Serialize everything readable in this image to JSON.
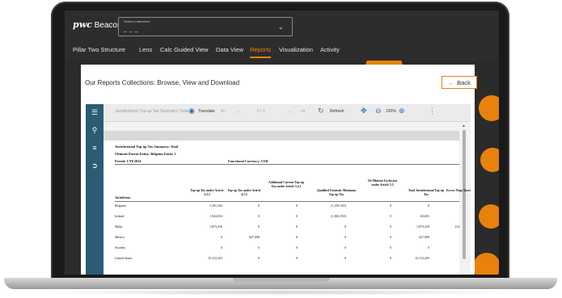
{
  "app": {
    "logo_bold": "pwc",
    "logo_text": "Beacon"
  },
  "selector": {
    "label": "Select a reference",
    "value": "_ _ _"
  },
  "nav": {
    "tabs": [
      {
        "label": "Pillar Two Structure"
      },
      {
        "label": "Lens"
      },
      {
        "label": "Calc Guided View"
      },
      {
        "label": "Data View"
      },
      {
        "label": "Reports"
      },
      {
        "label": "Visualization"
      },
      {
        "label": "Activity"
      }
    ]
  },
  "panel": {
    "title": "Our Reports Collections: Browse, View and Download",
    "back_label": "Back"
  },
  "toolbar": {
    "report_name": "Jurisdictional Top-up Tax Summary: Total",
    "translate": "Translate",
    "page": "1 / 1",
    "refresh": "Refresh",
    "zoom": "100%"
  },
  "report": {
    "title": "Jurisdictional Top-up Tax Summary: Total",
    "entity": "Ultimate Parent Entity: Belgium Entity 1",
    "period": "Period: CYE2024",
    "currency": "Functional Currency: USD",
    "columns": [
      "Jurisdiction",
      "Top-up Tax under Article 5.2.3",
      "Top-up Tax under Article 4.1.5",
      "Additional Current Top-up Tax under Article 5.4.1",
      "Qualified Domestic Minimum Top-up Tax",
      "De Minimis Exclusion under Article 5.5",
      "Total Jurisdictional Top-up Tax",
      "Excess Nega Taxes"
    ],
    "rows": [
      {
        "jurisdiction": "Belgium",
        "c1": "1,391,343",
        "c2": "0",
        "c3": "0",
        "c4": "(1,391,343)",
        "c5": "0",
        "c6": "0",
        "c7": ""
      },
      {
        "jurisdiction": "Ireland",
        "c1": "1,924,654",
        "c2": "0",
        "c3": "0",
        "c4": "(1,861,053)",
        "c5": "0",
        "c6": "63,601",
        "c7": ""
      },
      {
        "jurisdiction": "Malta",
        "c1": "1,873,410",
        "c2": "0",
        "c3": "0",
        "c4": "0",
        "c5": "0",
        "c6": "1,873,410",
        "c7": "114"
      },
      {
        "jurisdiction": "Mexico",
        "c1": "0",
        "c2": "627,000",
        "c3": "0",
        "c4": "0",
        "c5": "0",
        "c6": "627,000",
        "c7": ""
      },
      {
        "jurisdiction": "Sweden",
        "c1": "0",
        "c2": "0",
        "c3": "0",
        "c4": "0",
        "c5": "0",
        "c6": "0",
        "c7": ""
      },
      {
        "jurisdiction": "United States",
        "c1": "15,112,203",
        "c2": "0",
        "c3": "0",
        "c4": "0",
        "c5": "0",
        "c6": "15,112,203",
        "c7": ""
      }
    ]
  },
  "colors": {
    "accent": "#e8820c",
    "sidebar": "#2a5c74",
    "topbar": "#2d2d2d"
  }
}
